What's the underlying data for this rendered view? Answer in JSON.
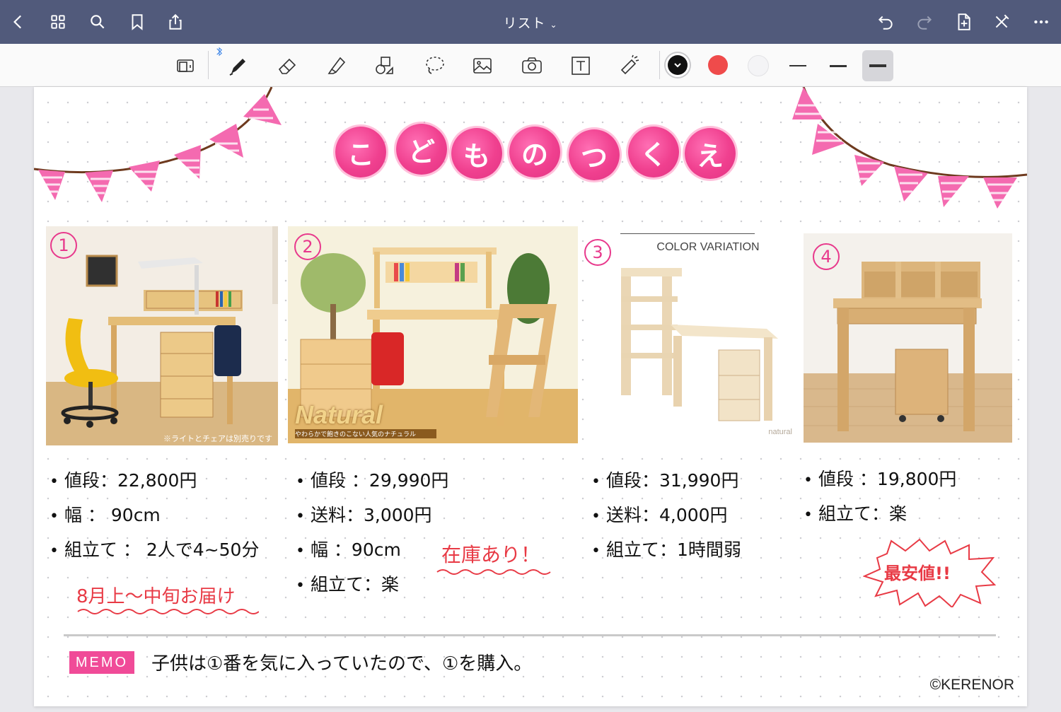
{
  "nav": {
    "title": "リスト",
    "caret": "⌄",
    "icons": [
      "chevron-left-icon",
      "grid-icon",
      "search-icon",
      "bookmark-icon",
      "share-icon",
      "undo-icon",
      "redo-icon",
      "add-page-icon",
      "close-pen-icon",
      "more-icon"
    ]
  },
  "toolbar": {
    "tools": [
      "read-mode-icon",
      "pen-icon",
      "eraser-icon",
      "highlighter-icon",
      "shapes-icon",
      "lasso-icon",
      "image-icon",
      "camera-icon",
      "text-icon",
      "laser-pointer-icon"
    ],
    "colors": [
      "#111111",
      "#ef4b4b",
      "#f2f2f4"
    ],
    "accent": "#515a7b"
  },
  "page": {
    "title_chars": [
      "こ",
      "ど",
      "も",
      "の",
      "つ",
      "く",
      "え"
    ],
    "items": [
      {
        "number": "1",
        "lines": [
          "値段：22,800円",
          "幅 ： 90cm",
          "組立て ： 2人で4~50分"
        ],
        "note": "8月上～中旬お届け",
        "caption": "※ライトとチェアは別売りです"
      },
      {
        "number": "2",
        "lines": [
          "値段 ：29,990円",
          "送料：3,000円",
          "幅 ：90cm",
          "組立て：楽"
        ],
        "note": "在庫あり！",
        "brand": "Natural",
        "brand_sub": "やわらかで飽きのこない人気のナチュラル"
      },
      {
        "number": "3",
        "lines": [
          "値段：31,990円",
          "送料：4,000円",
          "組立て：1時間弱"
        ],
        "label": "COLOR VARIATION",
        "caption": "natural"
      },
      {
        "number": "4",
        "lines": [
          "値段 ：19,800円",
          "組立て：楽"
        ],
        "note": "最安値!!"
      }
    ],
    "memo_label": "MEMO",
    "memo_text": "子供は①番を気に入っていたので、①を購入。",
    "copyright": "©KERENOR"
  }
}
